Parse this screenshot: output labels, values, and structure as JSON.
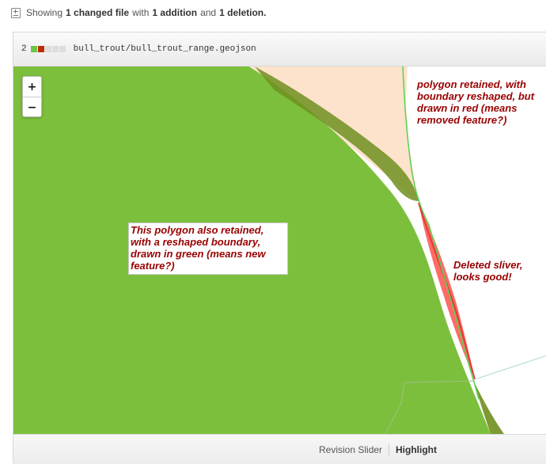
{
  "summary": {
    "prefix": "Showing",
    "changed_files": "1 changed file",
    "mid1": "with",
    "additions": "1 addition",
    "mid2": "and",
    "deletions": "1 deletion."
  },
  "file": {
    "change_count": "2",
    "diffstat": [
      "add",
      "del",
      "neutral",
      "neutral",
      "neutral"
    ],
    "filename": "bull_trout/bull_trout_range.geojson"
  },
  "map": {
    "zoom_in": "+",
    "zoom_out": "−",
    "colors": {
      "added": "#7cbf3c",
      "removed": "#ff6b66",
      "unchanged": "#6f8f1e",
      "background_polygon": "#fde3cc"
    },
    "annotations": {
      "top_right": "polygon retained, with boundary reshaped, but drawn in red (means removed feature?)",
      "center": "This polygon also retained, with a reshaped boundary, drawn in green (means new feature?)",
      "sliver": "Deleted sliver, looks good!"
    }
  },
  "footer": {
    "revision_slider": "Revision Slider",
    "highlight": "Highlight"
  }
}
